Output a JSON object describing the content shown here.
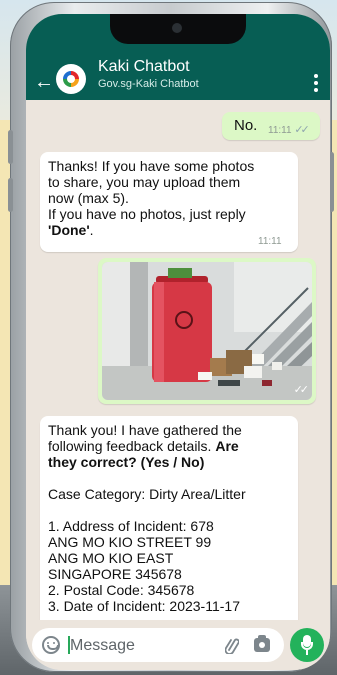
{
  "header": {
    "title": "Kaki Chatbot",
    "subtitle": "Gov.sg-Kaki Chatbot"
  },
  "messages": {
    "m1": {
      "text": "No.",
      "time": "11:11"
    },
    "m2": {
      "lines": [
        "Thanks! If you have some photos",
        "to share, you may upload them",
        "now (max 5).",
        "If you have no photos, just reply"
      ],
      "last_bold": "'Done'",
      "last_suffix": ".",
      "time": "11:11"
    },
    "m4": {
      "intro": "Thank you! I have gathered the",
      "intro2": "following feedback details.",
      "bold1": "Are",
      "bold2": "they correct? (Yes / No)",
      "category": "Case Category: Dirty Area/Litter",
      "lines": [
        "1. Address of Incident: 678",
        "ANG MO KIO STREET 99",
        "ANG MO KIO EAST",
        "SINGAPORE 345678",
        "2. Postal Code: 345678",
        "3. Date of Incident: 2023-11-17"
      ]
    }
  },
  "input": {
    "placeholder": "Message"
  },
  "colors": {
    "header": "#075e54",
    "outgoing_bubble": "#dcf8c6",
    "incoming_bubble": "#ffffff",
    "chat_bg": "#ece5dd",
    "mic_button": "#23b25b"
  },
  "icons": [
    "back-arrow-icon",
    "kaki-logo-icon",
    "more-vert-icon",
    "double-check-icon",
    "emoji-icon",
    "attach-icon",
    "camera-icon",
    "mic-icon"
  ]
}
